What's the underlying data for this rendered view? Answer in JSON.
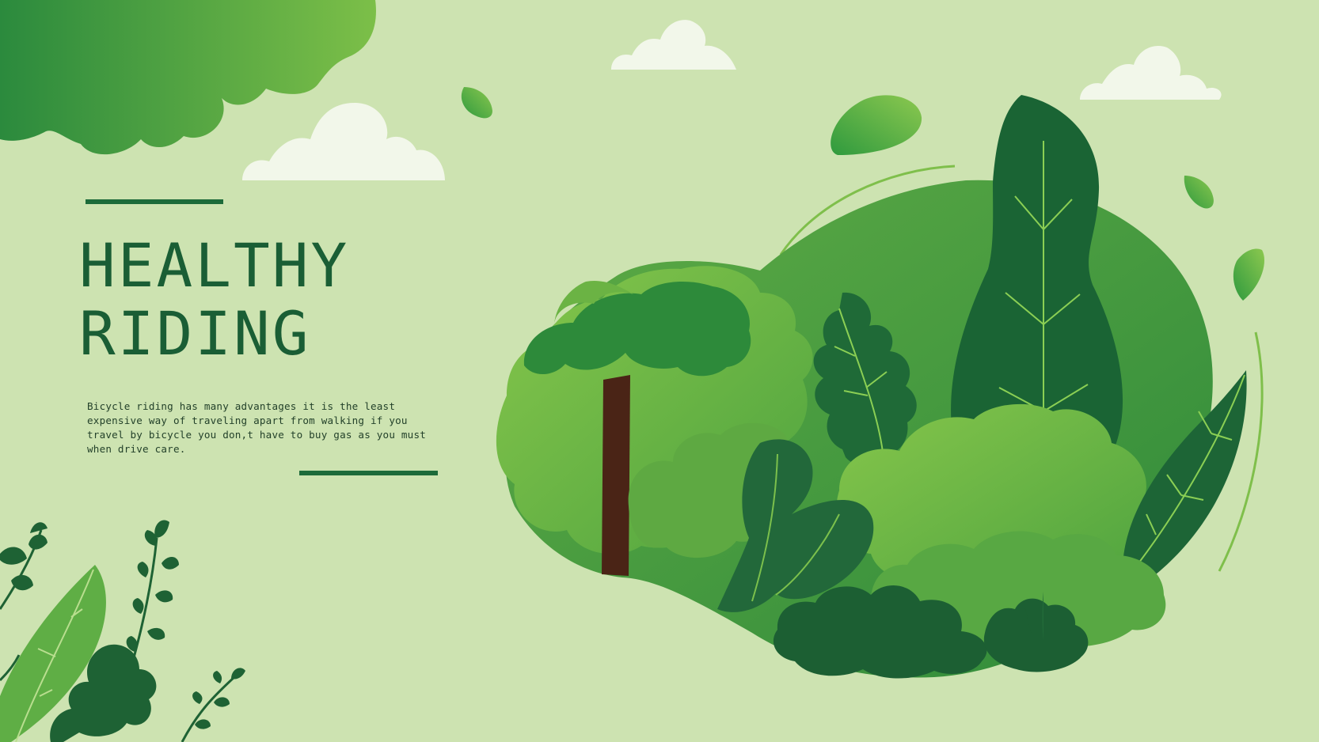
{
  "hero": {
    "title_line_1": "HEALTHY",
    "title_line_2": "RIDING",
    "body": "Bicycle riding has many advantages it is the least expensive way of traveling apart from walking if you travel by bicycle you don,t have to buy gas as you must when drive care."
  },
  "colors": {
    "background": "#cde3b1",
    "title": "#1a5e35",
    "accent_rule": "#1d6b3a",
    "dark_green": "#145a30",
    "mid_green": "#3d9a3f",
    "light_green": "#77b944",
    "trunk": "#4a2416",
    "cloud": "#f2f7ea"
  },
  "icons": [
    "tree-canopy-illustration",
    "cloud-icon",
    "leaf-icon",
    "fern-icon",
    "tree-trunk"
  ]
}
